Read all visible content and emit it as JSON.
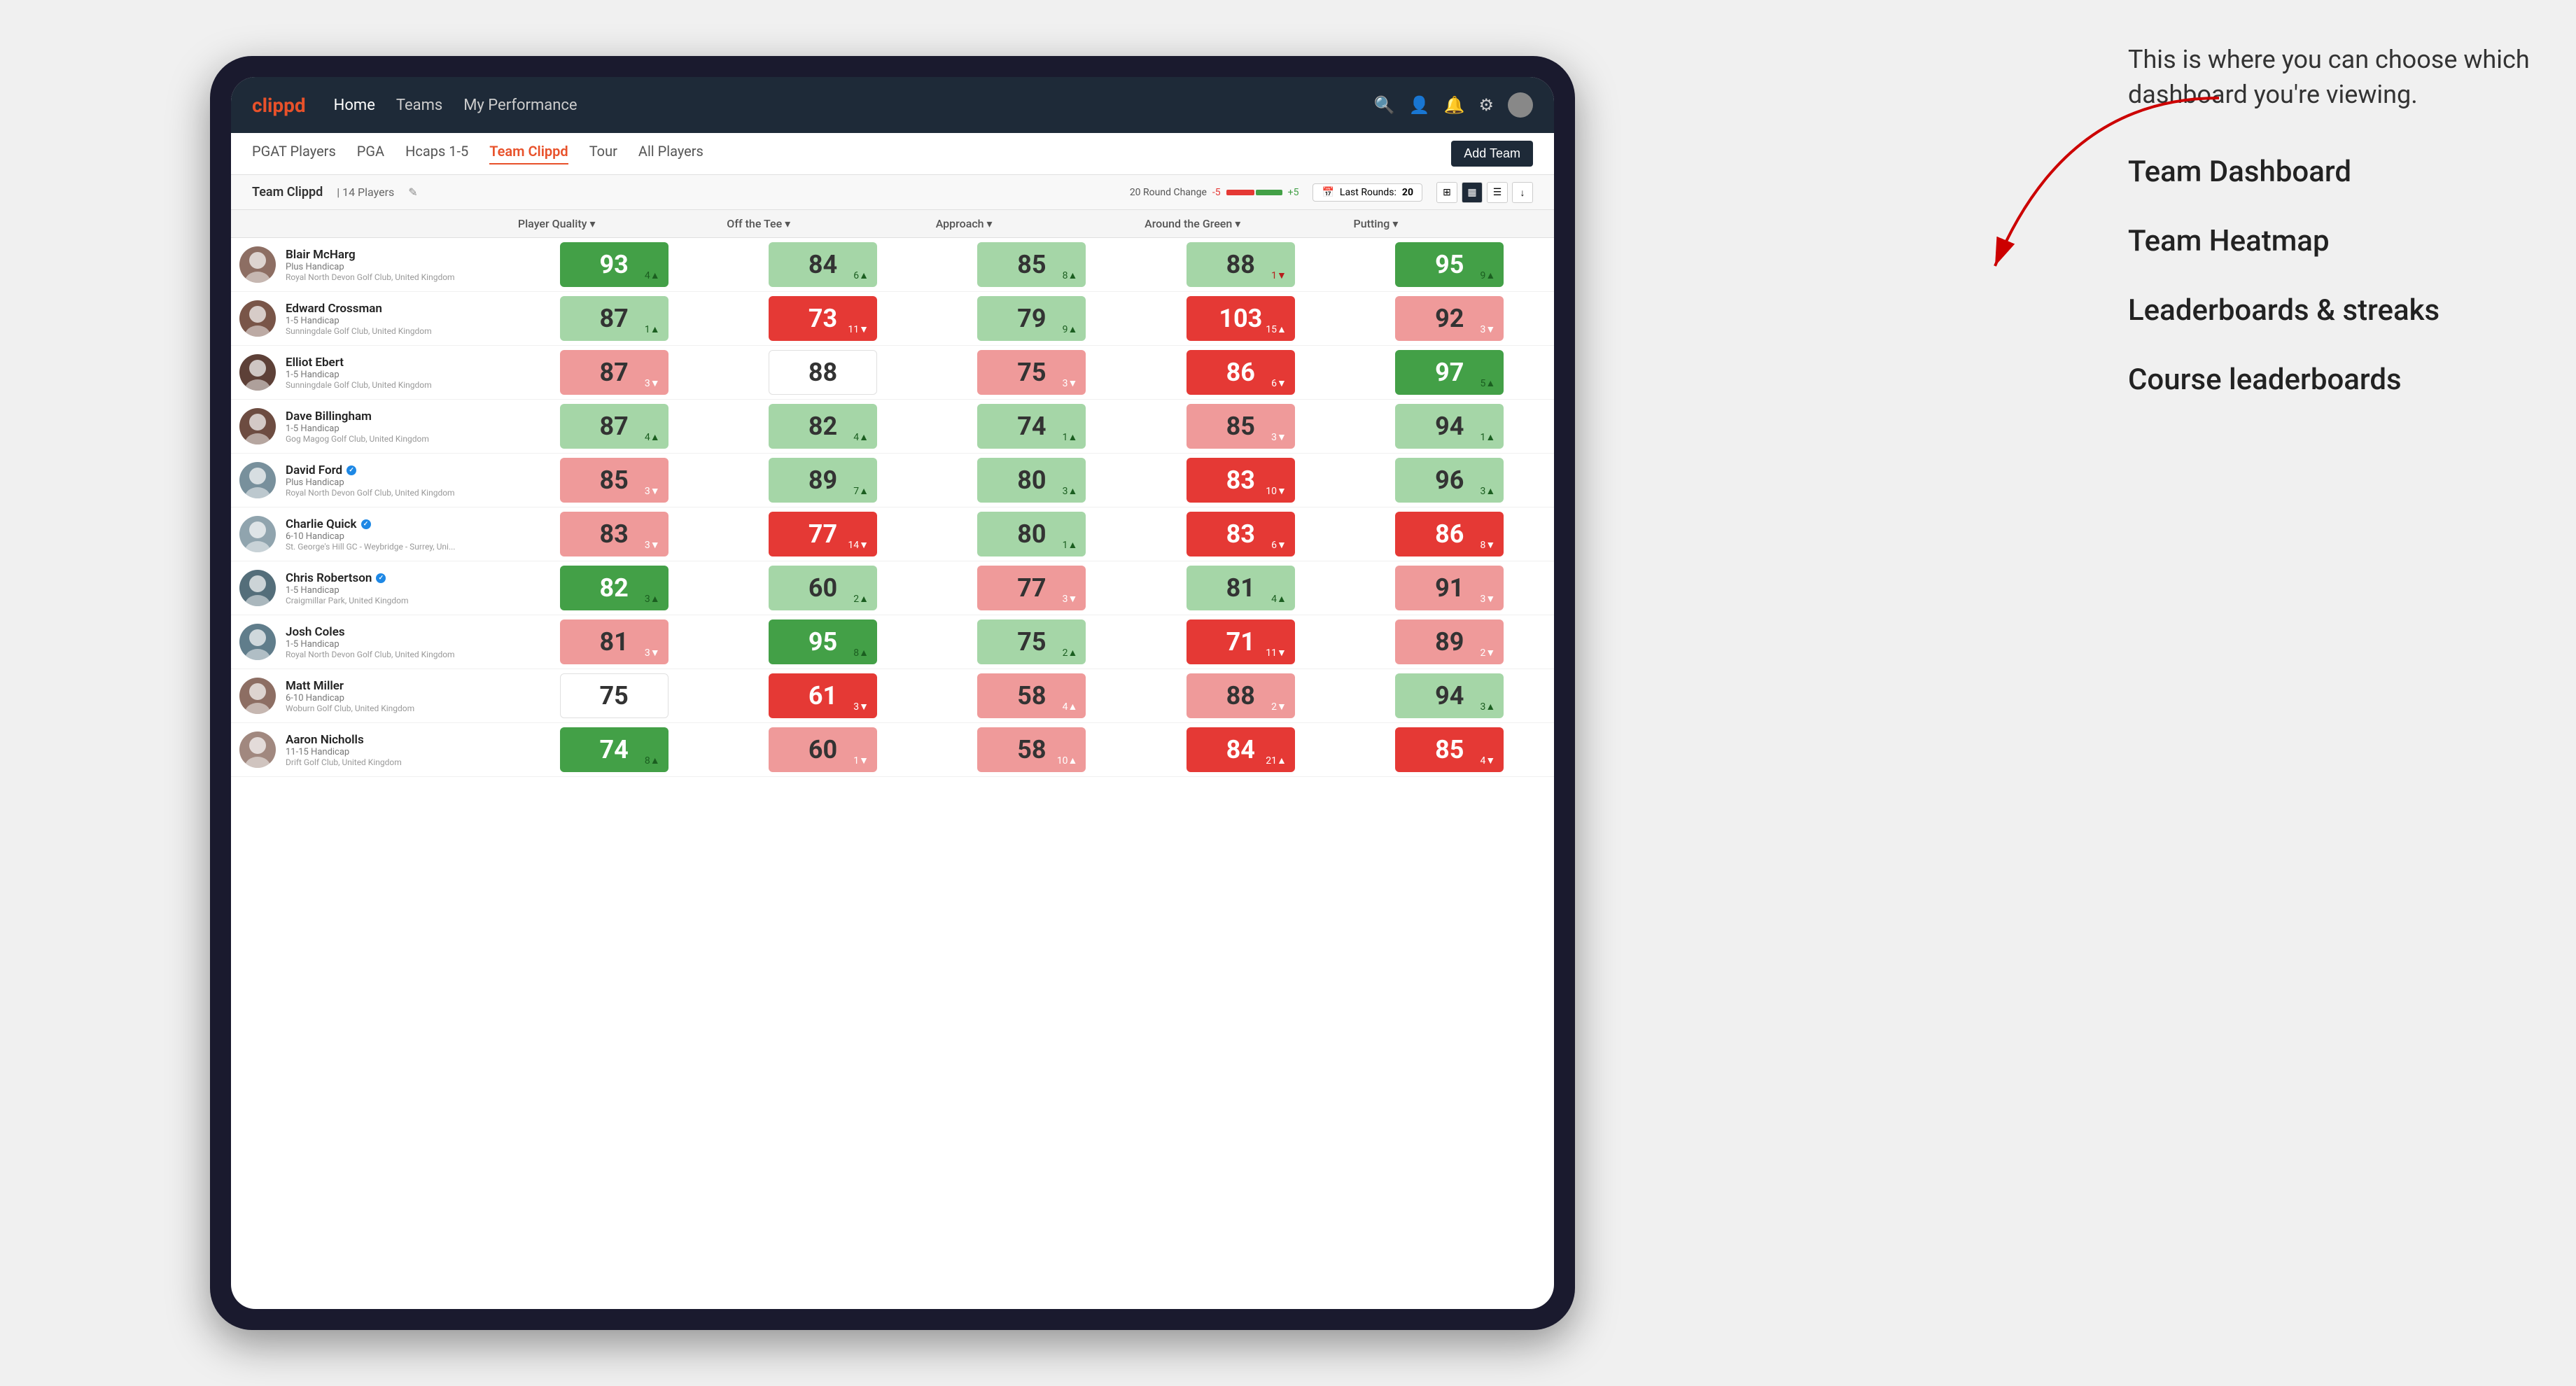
{
  "annotation": {
    "intro_text": "This is where you can choose which dashboard you're viewing.",
    "options": [
      "Team Dashboard",
      "Team Heatmap",
      "Leaderboards & streaks",
      "Course leaderboards"
    ]
  },
  "nav": {
    "logo": "clippd",
    "items": [
      "Home",
      "Teams",
      "My Performance"
    ],
    "icons": [
      "search",
      "person",
      "bell",
      "settings",
      "avatar"
    ]
  },
  "sub_nav": {
    "items": [
      "PGAT Players",
      "PGA",
      "Hcaps 1-5",
      "Team Clippd",
      "Tour",
      "All Players"
    ],
    "active": "Team Clippd",
    "add_button": "Add Team"
  },
  "team_bar": {
    "name": "Team Clippd",
    "separator": "|",
    "count": "14 Players",
    "round_change_label": "20 Round Change",
    "change_neg": "-5",
    "change_pos": "+5",
    "last_rounds_label": "Last Rounds:",
    "last_rounds_value": "20"
  },
  "table": {
    "headers": [
      {
        "label": "Player Quality ▾",
        "key": "player_quality"
      },
      {
        "label": "Off the Tee ▾",
        "key": "off_tee"
      },
      {
        "label": "Approach ▾",
        "key": "approach"
      },
      {
        "label": "Around the Green ▾",
        "key": "around_green"
      },
      {
        "label": "Putting ▾",
        "key": "putting"
      }
    ],
    "rows": [
      {
        "name": "Blair McHarg",
        "hcp": "Plus Handicap",
        "club": "Royal North Devon Golf Club, United Kingdom",
        "verified": false,
        "avatar_color": "#8d6e63",
        "player_quality": {
          "value": 93,
          "change": 4,
          "dir": "up",
          "bg": "green-dark"
        },
        "off_tee": {
          "value": 84,
          "change": 6,
          "dir": "up",
          "bg": "green-light"
        },
        "approach": {
          "value": 85,
          "change": 8,
          "dir": "up",
          "bg": "green-light"
        },
        "around_green": {
          "value": 88,
          "change": 1,
          "dir": "down",
          "bg": "green-light"
        },
        "putting": {
          "value": 95,
          "change": 9,
          "dir": "up",
          "bg": "green-dark"
        }
      },
      {
        "name": "Edward Crossman",
        "hcp": "1-5 Handicap",
        "club": "Sunningdale Golf Club, United Kingdom",
        "verified": false,
        "avatar_color": "#795548",
        "player_quality": {
          "value": 87,
          "change": 1,
          "dir": "up",
          "bg": "green-light"
        },
        "off_tee": {
          "value": 73,
          "change": 11,
          "dir": "down",
          "bg": "red-dark"
        },
        "approach": {
          "value": 79,
          "change": 9,
          "dir": "up",
          "bg": "green-light"
        },
        "around_green": {
          "value": 103,
          "change": 15,
          "dir": "up",
          "bg": "red-dark"
        },
        "putting": {
          "value": 92,
          "change": 3,
          "dir": "down",
          "bg": "red-light"
        }
      },
      {
        "name": "Elliot Ebert",
        "hcp": "1-5 Handicap",
        "club": "Sunningdale Golf Club, United Kingdom",
        "verified": false,
        "avatar_color": "#5d4037",
        "player_quality": {
          "value": 87,
          "change": 3,
          "dir": "down",
          "bg": "red-light"
        },
        "off_tee": {
          "value": 88,
          "change": null,
          "dir": "neutral",
          "bg": "white"
        },
        "approach": {
          "value": 75,
          "change": 3,
          "dir": "down",
          "bg": "red-light"
        },
        "around_green": {
          "value": 86,
          "change": 6,
          "dir": "down",
          "bg": "red-dark"
        },
        "putting": {
          "value": 97,
          "change": 5,
          "dir": "up",
          "bg": "green-dark"
        }
      },
      {
        "name": "Dave Billingham",
        "hcp": "1-5 Handicap",
        "club": "Gog Magog Golf Club, United Kingdom",
        "verified": false,
        "avatar_color": "#6d4c41",
        "player_quality": {
          "value": 87,
          "change": 4,
          "dir": "up",
          "bg": "green-light"
        },
        "off_tee": {
          "value": 82,
          "change": 4,
          "dir": "up",
          "bg": "green-light"
        },
        "approach": {
          "value": 74,
          "change": 1,
          "dir": "up",
          "bg": "green-light"
        },
        "around_green": {
          "value": 85,
          "change": 3,
          "dir": "down",
          "bg": "red-light"
        },
        "putting": {
          "value": 94,
          "change": 1,
          "dir": "up",
          "bg": "green-light"
        }
      },
      {
        "name": "David Ford",
        "hcp": "Plus Handicap",
        "club": "Royal North Devon Golf Club, United Kingdom",
        "verified": true,
        "avatar_color": "#78909c",
        "player_quality": {
          "value": 85,
          "change": 3,
          "dir": "down",
          "bg": "red-light"
        },
        "off_tee": {
          "value": 89,
          "change": 7,
          "dir": "up",
          "bg": "green-light"
        },
        "approach": {
          "value": 80,
          "change": 3,
          "dir": "up",
          "bg": "green-light"
        },
        "around_green": {
          "value": 83,
          "change": 10,
          "dir": "down",
          "bg": "red-dark"
        },
        "putting": {
          "value": 96,
          "change": 3,
          "dir": "up",
          "bg": "green-light"
        }
      },
      {
        "name": "Charlie Quick",
        "hcp": "6-10 Handicap",
        "club": "St. George's Hill GC - Weybridge - Surrey, Uni...",
        "verified": true,
        "avatar_color": "#90a4ae",
        "player_quality": {
          "value": 83,
          "change": 3,
          "dir": "down",
          "bg": "red-light"
        },
        "off_tee": {
          "value": 77,
          "change": 14,
          "dir": "down",
          "bg": "red-dark"
        },
        "approach": {
          "value": 80,
          "change": 1,
          "dir": "up",
          "bg": "green-light"
        },
        "around_green": {
          "value": 83,
          "change": 6,
          "dir": "down",
          "bg": "red-dark"
        },
        "putting": {
          "value": 86,
          "change": 8,
          "dir": "down",
          "bg": "red-dark"
        }
      },
      {
        "name": "Chris Robertson",
        "hcp": "1-5 Handicap",
        "club": "Craigmillar Park, United Kingdom",
        "verified": true,
        "avatar_color": "#546e7a",
        "player_quality": {
          "value": 82,
          "change": 3,
          "dir": "up",
          "bg": "green-dark"
        },
        "off_tee": {
          "value": 60,
          "change": 2,
          "dir": "up",
          "bg": "green-light"
        },
        "approach": {
          "value": 77,
          "change": 3,
          "dir": "down",
          "bg": "red-light"
        },
        "around_green": {
          "value": 81,
          "change": 4,
          "dir": "up",
          "bg": "green-light"
        },
        "putting": {
          "value": 91,
          "change": 3,
          "dir": "down",
          "bg": "red-light"
        }
      },
      {
        "name": "Josh Coles",
        "hcp": "1-5 Handicap",
        "club": "Royal North Devon Golf Club, United Kingdom",
        "verified": false,
        "avatar_color": "#607d8b",
        "player_quality": {
          "value": 81,
          "change": 3,
          "dir": "down",
          "bg": "red-light"
        },
        "off_tee": {
          "value": 95,
          "change": 8,
          "dir": "up",
          "bg": "green-dark"
        },
        "approach": {
          "value": 75,
          "change": 2,
          "dir": "up",
          "bg": "green-light"
        },
        "around_green": {
          "value": 71,
          "change": 11,
          "dir": "down",
          "bg": "red-dark"
        },
        "putting": {
          "value": 89,
          "change": 2,
          "dir": "down",
          "bg": "red-light"
        }
      },
      {
        "name": "Matt Miller",
        "hcp": "6-10 Handicap",
        "club": "Woburn Golf Club, United Kingdom",
        "verified": false,
        "avatar_color": "#8d6e63",
        "player_quality": {
          "value": 75,
          "change": null,
          "dir": "neutral",
          "bg": "white"
        },
        "off_tee": {
          "value": 61,
          "change": 3,
          "dir": "down",
          "bg": "red-dark"
        },
        "approach": {
          "value": 58,
          "change": 4,
          "dir": "up",
          "bg": "red-light"
        },
        "around_green": {
          "value": 88,
          "change": 2,
          "dir": "down",
          "bg": "red-light"
        },
        "putting": {
          "value": 94,
          "change": 3,
          "dir": "up",
          "bg": "green-light"
        }
      },
      {
        "name": "Aaron Nicholls",
        "hcp": "11-15 Handicap",
        "club": "Drift Golf Club, United Kingdom",
        "verified": false,
        "avatar_color": "#a1887f",
        "player_quality": {
          "value": 74,
          "change": 8,
          "dir": "up",
          "bg": "green-dark"
        },
        "off_tee": {
          "value": 60,
          "change": 1,
          "dir": "down",
          "bg": "red-light"
        },
        "approach": {
          "value": 58,
          "change": 10,
          "dir": "up",
          "bg": "red-light"
        },
        "around_green": {
          "value": 84,
          "change": 21,
          "dir": "up",
          "bg": "red-dark"
        },
        "putting": {
          "value": 85,
          "change": 4,
          "dir": "down",
          "bg": "red-dark"
        }
      }
    ]
  }
}
